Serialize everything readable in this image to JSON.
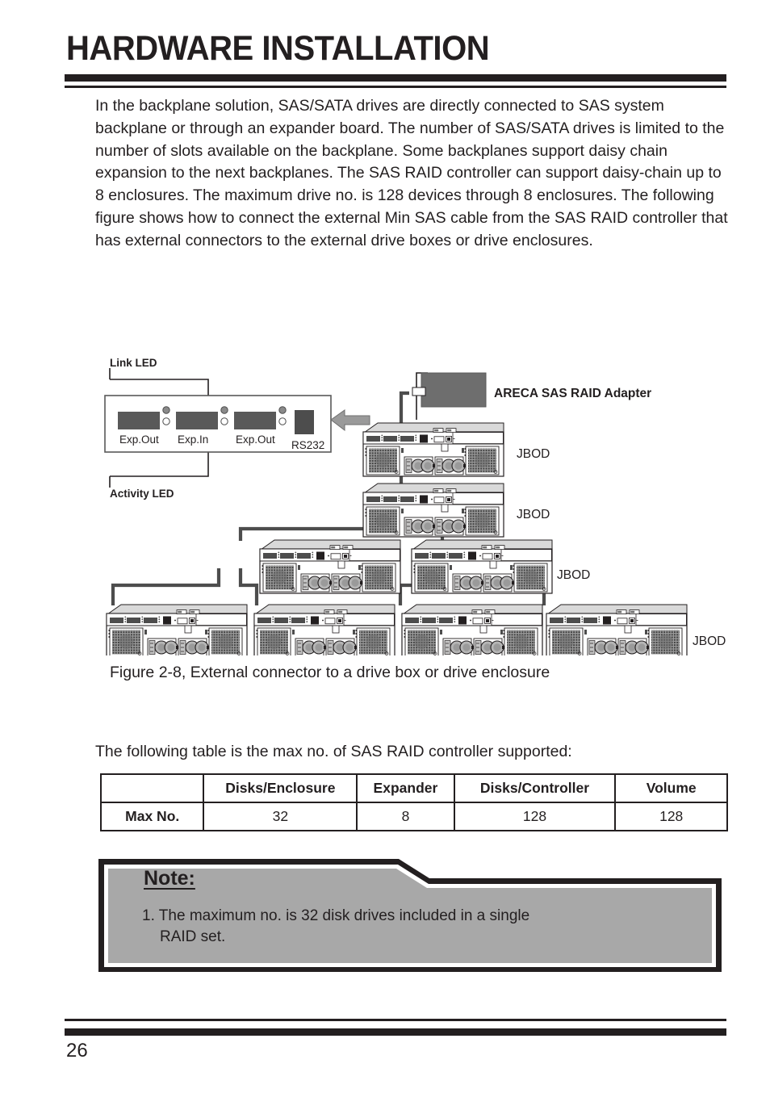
{
  "header": {
    "title": "HARDWARE INSTALLATION"
  },
  "body": {
    "paragraph": "In the backplane solution, SAS/SATA drives are directly connected to SAS system backplane or through an expander board. The number of SAS/SATA drives is limited to the number of slots available on the backplane. Some backplanes support daisy chain expansion to the next backplanes. The SAS RAID controller can support daisy-chain up to 8 enclosures. The maximum drive no. is 128 devices through 8 enclosures. The following figure shows how to connect the external Min SAS cable from the SAS RAID controller that has external connectors to the external drive boxes or drive enclosures."
  },
  "figure": {
    "caption": "Figure 2-8, External connector to a drive box or drive enclosure",
    "expander_panel": {
      "link_led_label": "Link LED",
      "activity_led_label": "Activity LED",
      "ports": [
        "Exp.Out",
        "Exp.In",
        "Exp.Out"
      ],
      "serial_port_label": "RS232"
    },
    "adapter_label": "ARECA SAS RAID Adapter",
    "jbod_labels": [
      "JBOD",
      "JBOD",
      "JBOD",
      "JBOD"
    ],
    "colors": {
      "panel_fill": "#ffffff",
      "port_fill": "#595959",
      "adapter_fill": "#6e6e6e",
      "arrow_fill": "#9a9a9a",
      "enclosure_top": "#d9d9d9",
      "enclosure_body": "#ffffff",
      "grille_fill": "#4d4d4d",
      "cable_stroke": "#4d4d4d",
      "outline": "#231f20"
    }
  },
  "table_intro": "The following table is the max no. of SAS RAID controller supported:",
  "spec_table": {
    "headers": [
      "",
      "Disks/Enclosure",
      "Expander",
      "Disks/Controller",
      "Volume"
    ],
    "rows": [
      {
        "label": "Max No.",
        "values": [
          "32",
          "8",
          "128",
          "128"
        ]
      }
    ]
  },
  "note": {
    "title": "Note:",
    "items": [
      {
        "number": "1.",
        "line1": "The maximum no. is 32 disk drives included in a single",
        "line2": "RAID set."
      }
    ],
    "fill_color": "#a8a8a8",
    "border_color": "#231f20"
  },
  "footer": {
    "page_number": "26"
  }
}
